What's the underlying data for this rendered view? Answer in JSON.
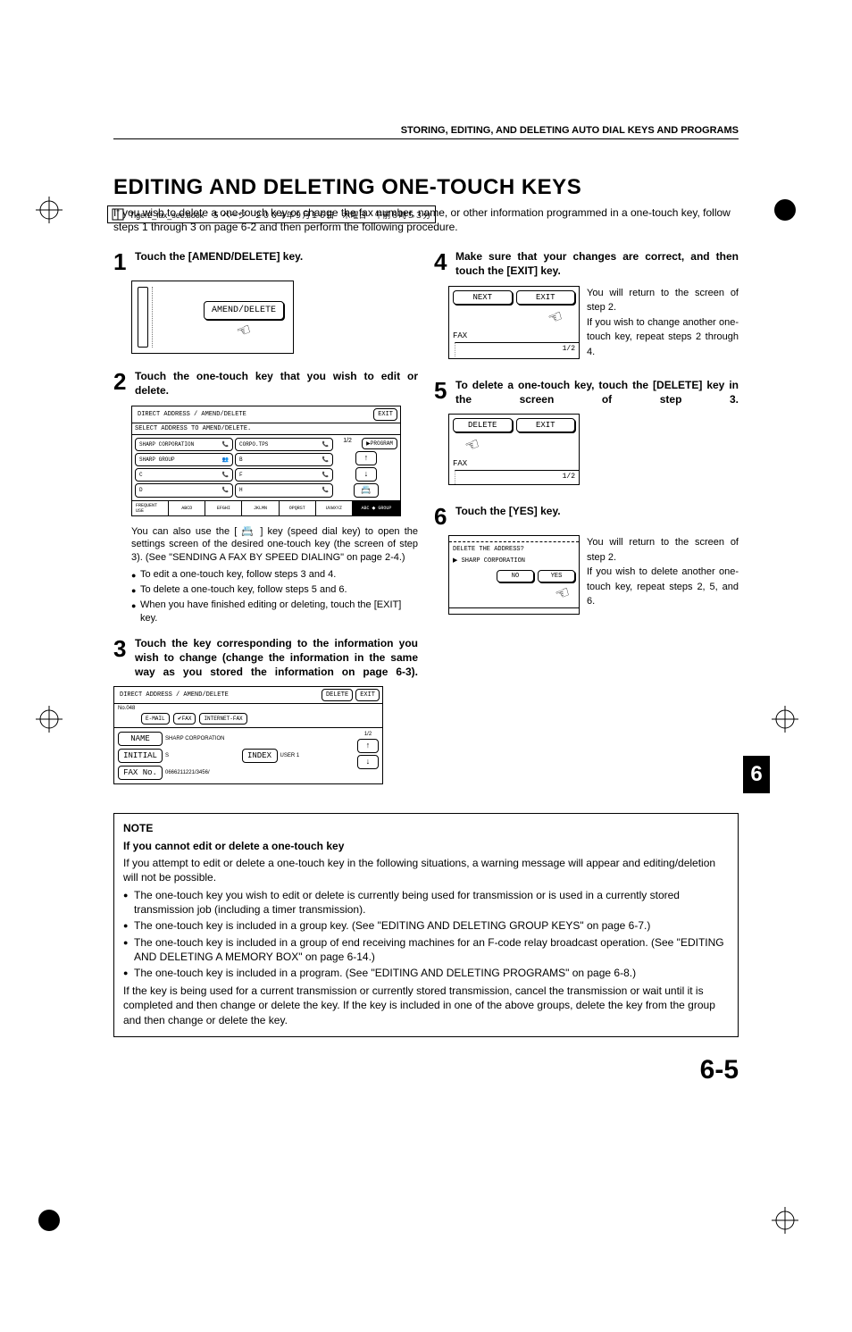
{
  "header_meta": "Tiger2_fax_sec.book　５ ページ　２００４年９月１６日　木曜日　午前８時５３分",
  "breadcrumb": "STORING, EDITING, AND DELETING AUTO DIAL KEYS AND PROGRAMS",
  "title": "EDITING AND DELETING ONE-TOUCH KEYS",
  "intro": "If you wish to delete a one-touch key or change the fax number, name, or other information programmed in a one-touch key, follow steps 1 through 3 on page 6-2 and then perform the following procedure.",
  "steps": {
    "s1": {
      "num": "1",
      "title": "Touch the [AMEND/DELETE] key.",
      "panel_btn": "AMEND/DELETE"
    },
    "s2": {
      "num": "2",
      "title": "Touch the one-touch key that you wish to edit or delete.",
      "panel": {
        "header": "DIRECT ADDRESS / AMEND/DELETE",
        "sub": "SELECT ADDRESS TO AMEND/DELETE.",
        "exit": "EXIT",
        "cells": [
          "SHARP CORPORATION",
          "CORPO.TPS",
          "SHARP GROUP",
          "B",
          "C",
          "F",
          "D",
          "H"
        ],
        "page": "1/2",
        "program": "PROGRAM",
        "tabs": [
          "FREQUENT USE",
          "ABCD",
          "EFGHI",
          "JKLMN",
          "OPQRST",
          "UVWXYZ"
        ],
        "tabs_right": "ABC ◆ GROUP"
      },
      "body": "You can also use the [ 📇 ] key (speed dial key) to open the settings screen of the desired one-touch key (the screen of step 3). (See \"SENDING A FAX BY SPEED DIALING\" on page 2-4.)",
      "bullets": [
        "To edit a one-touch key, follow steps 3 and 4.",
        "To delete a one-touch key, follow steps 5 and 6.",
        "When you have finished editing or deleting, touch the [EXIT] key."
      ]
    },
    "s3": {
      "num": "3",
      "title": "Touch the key corresponding to the information you wish to change (change the information in the same way as you stored the information on page 6-3).",
      "panel": {
        "header": "DIRECT ADDRESS / AMEND/DELETE",
        "no": "No.048",
        "delete": "DELETE",
        "exit": "EXIT",
        "tabs": [
          "E-MAIL",
          "FAX",
          "INTERNET-FAX"
        ],
        "rows": {
          "name_l": "NAME",
          "name_v": "SHARP CORPORATION",
          "init_l": "INITIAL",
          "init_v": "S",
          "index_l": "INDEX",
          "index_v": "USER 1",
          "fax_l": "FAX No.",
          "fax_v": "0666211221/3456/"
        },
        "page": "1/2"
      }
    },
    "s4": {
      "num": "4",
      "title": "Make sure that your changes are correct, and then touch the [EXIT] key.",
      "panel": {
        "next": "NEXT",
        "exit": "EXIT",
        "mode": "FAX",
        "page": "1/2"
      },
      "body": "You will return to the screen of step 2.\nIf you wish to change another one-touch key, repeat steps 2 through 4."
    },
    "s5": {
      "num": "5",
      "title": "To delete a one-touch key, touch the [DELETE] key in the screen of step 3.",
      "panel": {
        "delete": "DELETE",
        "exit": "EXIT",
        "mode": "FAX",
        "page": "1/2"
      }
    },
    "s6": {
      "num": "6",
      "title": "Touch the [YES] key.",
      "panel": {
        "q": "DELETE THE ADDRESS?",
        "sub": "SHARP CORPORATION",
        "no": "NO",
        "yes": "YES"
      },
      "body": "You will return to the screen of step 2.\nIf you wish to delete another one-touch key, repeat steps 2, 5, and 6."
    }
  },
  "note": {
    "label": "NOTE",
    "heading": "If you cannot edit or delete a one-touch key",
    "p1": "If you attempt to edit or delete a one-touch key in the following situations, a warning message will appear and editing/deletion will not be possible.",
    "bullets": [
      "The one-touch key you wish to edit or delete is currently being used for transmission or is used in a currently stored transmission job (including a timer transmission).",
      "The one-touch key is included in a group key. (See \"EDITING AND DELETING GROUP KEYS\" on page 6-7.)",
      "The one-touch key is included in a group of end receiving machines for an F-code relay broadcast operation. (See \"EDITING AND DELETING A MEMORY BOX\" on page 6-14.)",
      "The one-touch key is included in a program. (See \"EDITING AND DELETING PROGRAMS\" on page 6-8.)"
    ],
    "p2": "If the key is being used for a current transmission or currently stored transmission, cancel the transmission or wait until it is completed and then change or delete the key. If the key is included in one of the above groups, delete the key from the group and then change or delete the key."
  },
  "sidetab": "6",
  "pagenum": "6-5"
}
